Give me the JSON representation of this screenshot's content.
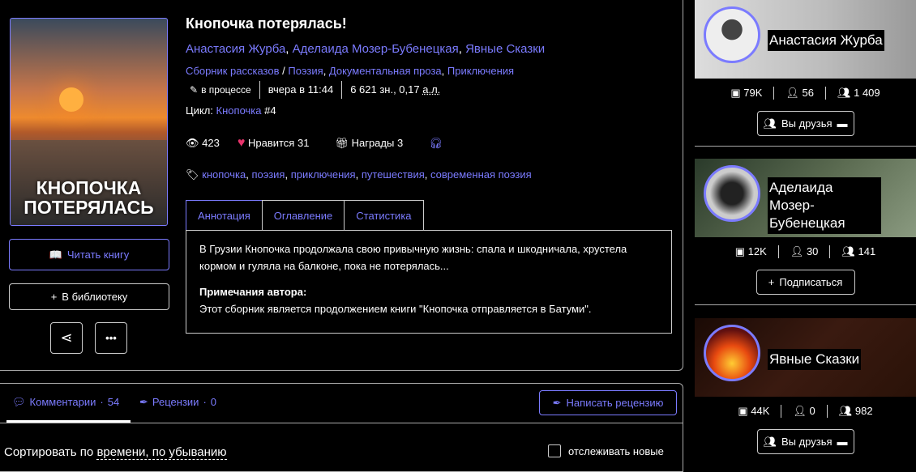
{
  "book": {
    "title": "Кнопочка потерялась!",
    "cover_text": "КНОПОЧКА ПОТЕРЯЛАСЬ",
    "authors": [
      "Анастасия Журба",
      "Аделаида Мозер-Бубенецкая",
      "Явные Сказки"
    ],
    "form": "Сборник рассказов",
    "genres": [
      "Поэзия",
      "Документальная проза",
      "Приключения"
    ],
    "status": "в процессе",
    "updated": "вчера в 11:44",
    "size": "6 621 зн., 0,17",
    "size_unit": "а.л.",
    "cycle_label": "Цикл:",
    "cycle": "Кнопочка",
    "cycle_num": "#4",
    "views": "423",
    "likes_label": "Нравится",
    "likes": "31",
    "awards_label": "Награды",
    "awards": "3",
    "tags": [
      "кнопочка",
      "поэзия",
      "приключения",
      "путешествия",
      "современная поэзия"
    ]
  },
  "actions": {
    "read": "Читать книгу",
    "library": "В библиотеку"
  },
  "tabs": [
    "Аннотация",
    "Оглавление",
    "Статистика"
  ],
  "annotation": {
    "text": "В Грузии Кнопочка продолжала свою привычную жизнь: спала и шкодничала, хрустела кормом и гуляла на балконе, пока не потерялась...",
    "notes_title": "Примечания автора:",
    "notes": "Этот сборник является продолжением книги \"Кнопочка отправляется в Батуми\"."
  },
  "comments": {
    "tab_comments": "Комментарии",
    "comments_count": "54",
    "tab_reviews": "Рецензии",
    "reviews_count": "0",
    "write_review": "Написать рецензию",
    "sort_prefix": "Сортировать по",
    "sort_by": "времени",
    "sort_order": "по убыванию",
    "track_label": "отслеживать новые"
  },
  "authors_panel": [
    {
      "name": "Анастасия Журба",
      "books": "79K",
      "friends": "56",
      "followers": "1 409",
      "button": "Вы друзья"
    },
    {
      "name": "Аделаида Мозер-Бубенецкая",
      "books": "12K",
      "friends": "30",
      "followers": "141",
      "button": "Подписаться"
    },
    {
      "name": "Явные Сказки",
      "books": "44K",
      "friends": "0",
      "followers": "982",
      "button": "Вы друзья"
    }
  ],
  "colors": {
    "accent": "#7b7bff",
    "like": "#e8336b"
  }
}
